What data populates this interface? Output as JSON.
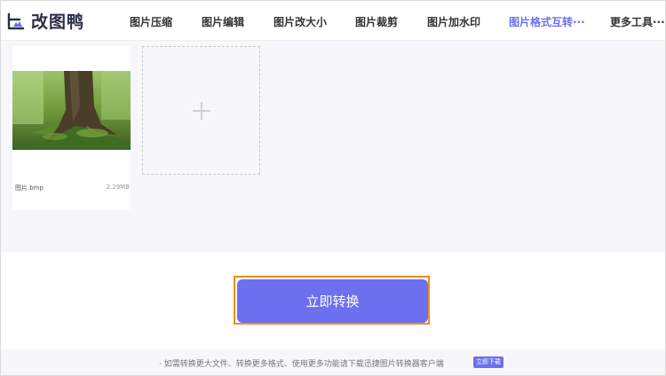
{
  "app": {
    "logo_text": "改图鸭"
  },
  "nav": {
    "items": [
      {
        "label": "图片压缩",
        "active": false
      },
      {
        "label": "图片编辑",
        "active": false
      },
      {
        "label": "图片改大小",
        "active": false
      },
      {
        "label": "图片裁剪",
        "active": false
      },
      {
        "label": "图片加水印",
        "active": false
      },
      {
        "label": "图片格式互转···",
        "active": true
      },
      {
        "label": "更多工具···",
        "active": false
      }
    ]
  },
  "file": {
    "name": "图片.bmp",
    "size": "2.29MB"
  },
  "add_box": {
    "icon": "plus-icon"
  },
  "convert": {
    "label": "立即转换"
  },
  "footer": {
    "notice": "· 如需转换更大文件、转换更多格式、使用更多功能请下载迅捷图片转换器客户端",
    "download_label": "立即下载"
  },
  "colors": {
    "accent": "#6c70ee",
    "highlight_border": "#f08b1d"
  }
}
